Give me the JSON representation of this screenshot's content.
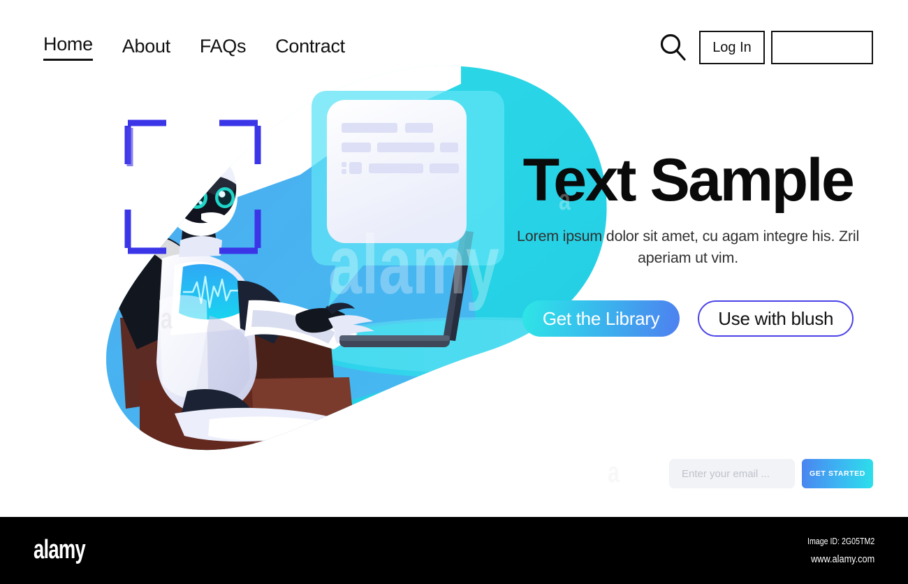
{
  "header": {
    "nav": [
      {
        "label": "Home",
        "active": true
      },
      {
        "label": "About",
        "active": false
      },
      {
        "label": "FAQs",
        "active": false
      },
      {
        "label": "Contract",
        "active": false
      }
    ],
    "search_icon": "search-icon",
    "login_label": "Log In",
    "signup_label": ""
  },
  "hero": {
    "title": "Text Sample",
    "subtitle": "Lorem ipsum dolor sit amet, cu agam integre his. Zril aperiam ut vim.",
    "primary_cta": "Get the Library",
    "secondary_cta": "Use with blush"
  },
  "signup": {
    "placeholder": "Enter your email ...",
    "value": "",
    "button_label": "GET STARTED"
  },
  "illustration": {
    "robot": "robot-character",
    "scanner": "face-scanner-brackets",
    "speech_bubble": "chat-bubble-card",
    "laptop": "laptop-device",
    "chair": "office-chair",
    "desk": "desk-surface"
  },
  "footer": {
    "logo": "alamy",
    "image_id": "Image ID: 2G05TM2",
    "url": "www.alamy.com"
  },
  "colors": {
    "cyan": "#2ad7e8",
    "light_blue": "#4bb8f0",
    "accent_blue": "#4e7ff0",
    "indigo": "#4b42e8",
    "scanner_blue": "#3b35e8",
    "text_dark": "#0a0a0a",
    "footer_bg": "#000000"
  }
}
